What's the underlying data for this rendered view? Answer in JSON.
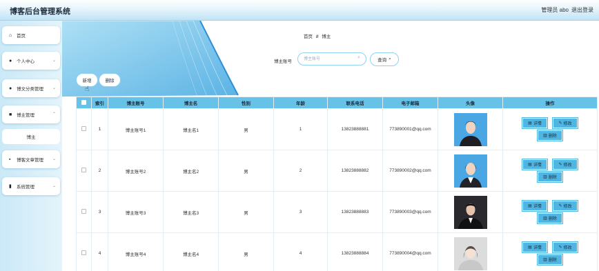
{
  "app": {
    "title": "博客后台管理系统",
    "user": "管理员 abo",
    "logout": "退出登录"
  },
  "sidebar": {
    "items": [
      {
        "label": "首页",
        "icon": "home-icon",
        "glyph": "⌂"
      },
      {
        "label": "个人中心",
        "icon": "user-icon",
        "glyph": "●"
      },
      {
        "label": "博文分类管理",
        "icon": "user-icon",
        "glyph": "●"
      },
      {
        "label": "博主管理",
        "icon": "briefcase-icon",
        "glyph": "■"
      },
      {
        "label": "博客文章管理",
        "icon": "grid-icon",
        "glyph": "▪"
      },
      {
        "label": "系统管理",
        "icon": "chart-icon",
        "glyph": "▮"
      }
    ],
    "active_sub": "博主",
    "arrow": "⌄"
  },
  "breadcrumb": {
    "home": "首页",
    "sep": "//",
    "current": "博主"
  },
  "search": {
    "label": "博主账号",
    "placeholder": "博主账号",
    "button": "查询",
    "icon": "search-icon"
  },
  "actions": {
    "add": "新增",
    "delete": "删除"
  },
  "table": {
    "headers": [
      "",
      "索引",
      "博主账号",
      "博主名",
      "性别",
      "年龄",
      "联系电话",
      "电子邮箱",
      "头像",
      "操作"
    ],
    "rows": [
      {
        "index": "1",
        "account": "博主账号1",
        "name": "博主名1",
        "gender": "男",
        "age": "1",
        "phone": "13823888881",
        "email": "773890001@qq.com"
      },
      {
        "index": "2",
        "account": "博主账号2",
        "name": "博主名2",
        "gender": "男",
        "age": "2",
        "phone": "13823888882",
        "email": "773890002@qq.com"
      },
      {
        "index": "3",
        "account": "博主账号3",
        "name": "博主名3",
        "gender": "男",
        "age": "3",
        "phone": "13823888883",
        "email": "773890003@qq.com"
      },
      {
        "index": "4",
        "account": "博主账号4",
        "name": "博主名4",
        "gender": "男",
        "age": "4",
        "phone": "13823888884",
        "email": "773890004@qq.com"
      }
    ],
    "ops": {
      "detail": "详情",
      "edit": "修改",
      "delete": "删除"
    }
  },
  "colors": {
    "accent": "#66c2e6",
    "button": "#4fb6e3",
    "border": "#8fd0ee"
  }
}
